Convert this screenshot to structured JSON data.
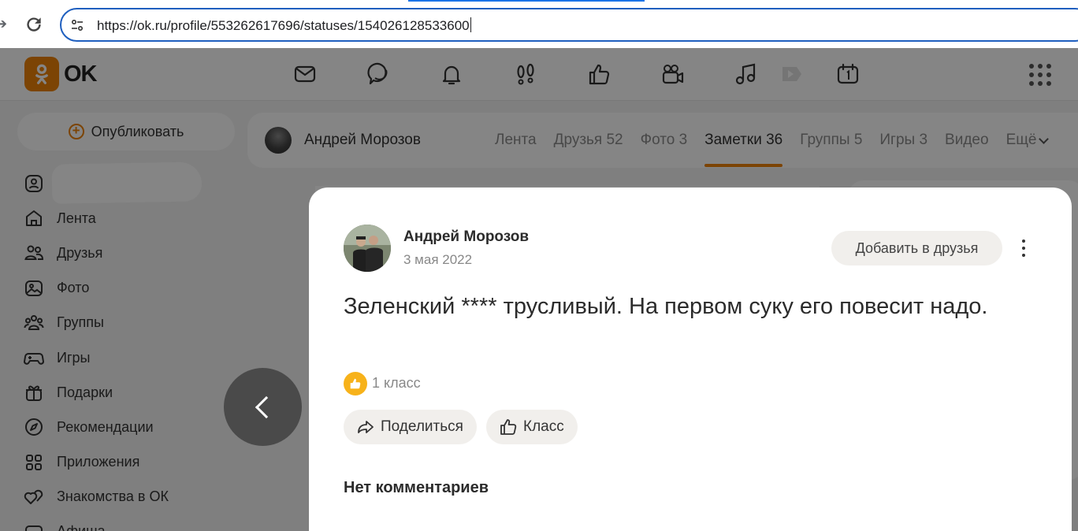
{
  "browser": {
    "url": "https://ok.ru/profile/553262617696/statuses/154026128533600"
  },
  "header": {
    "logo_text": "OK",
    "icons": [
      "mail-icon",
      "chat-icon",
      "bell-icon",
      "footprints-icon",
      "thumbs-up-icon",
      "video-camera-icon",
      "music-icon",
      "play-icon",
      "calendar-icon",
      "grid-menu-icon"
    ]
  },
  "sidebar": {
    "publish_label": "Опубликовать",
    "items": [
      {
        "label": "",
        "icon": "user-icon"
      },
      {
        "label": "Лента",
        "icon": "home-icon"
      },
      {
        "label": "Друзья",
        "icon": "friends-icon"
      },
      {
        "label": "Фото",
        "icon": "photo-icon"
      },
      {
        "label": "Группы",
        "icon": "groups-icon"
      },
      {
        "label": "Игры",
        "icon": "gamepad-icon"
      },
      {
        "label": "Подарки",
        "icon": "gift-icon"
      },
      {
        "label": "Рекомендации",
        "icon": "compass-icon"
      },
      {
        "label": "Приложения",
        "icon": "apps-icon"
      },
      {
        "label": "Знакомства в ОК",
        "icon": "hearts-icon"
      },
      {
        "label": "Афиша",
        "icon": "ticket-icon"
      }
    ]
  },
  "profile": {
    "name": "Андрей Морозов",
    "tabs": [
      {
        "label": "Лента",
        "active": false
      },
      {
        "label": "Друзья 52",
        "active": false
      },
      {
        "label": "Фото 3",
        "active": false
      },
      {
        "label": "Заметки 36",
        "active": true
      },
      {
        "label": "Группы 5",
        "active": false
      },
      {
        "label": "Игры 3",
        "active": false
      },
      {
        "label": "Видео",
        "active": false
      }
    ],
    "more_label": "Ещё"
  },
  "post": {
    "author": "Андрей Морозов",
    "date": "3 мая 2022",
    "add_friend_label": "Добавить в друзья",
    "text": "Зеленский **** трусливый. На первом суку его повесит надо.",
    "class_count": "1 класс",
    "share_label": "Поделиться",
    "class_label": "Класс",
    "no_comments": "Нет комментариев"
  },
  "colors": {
    "brand": "#ee8208",
    "url_border": "#1f5fbf",
    "class_badge": "#f7b21a"
  }
}
